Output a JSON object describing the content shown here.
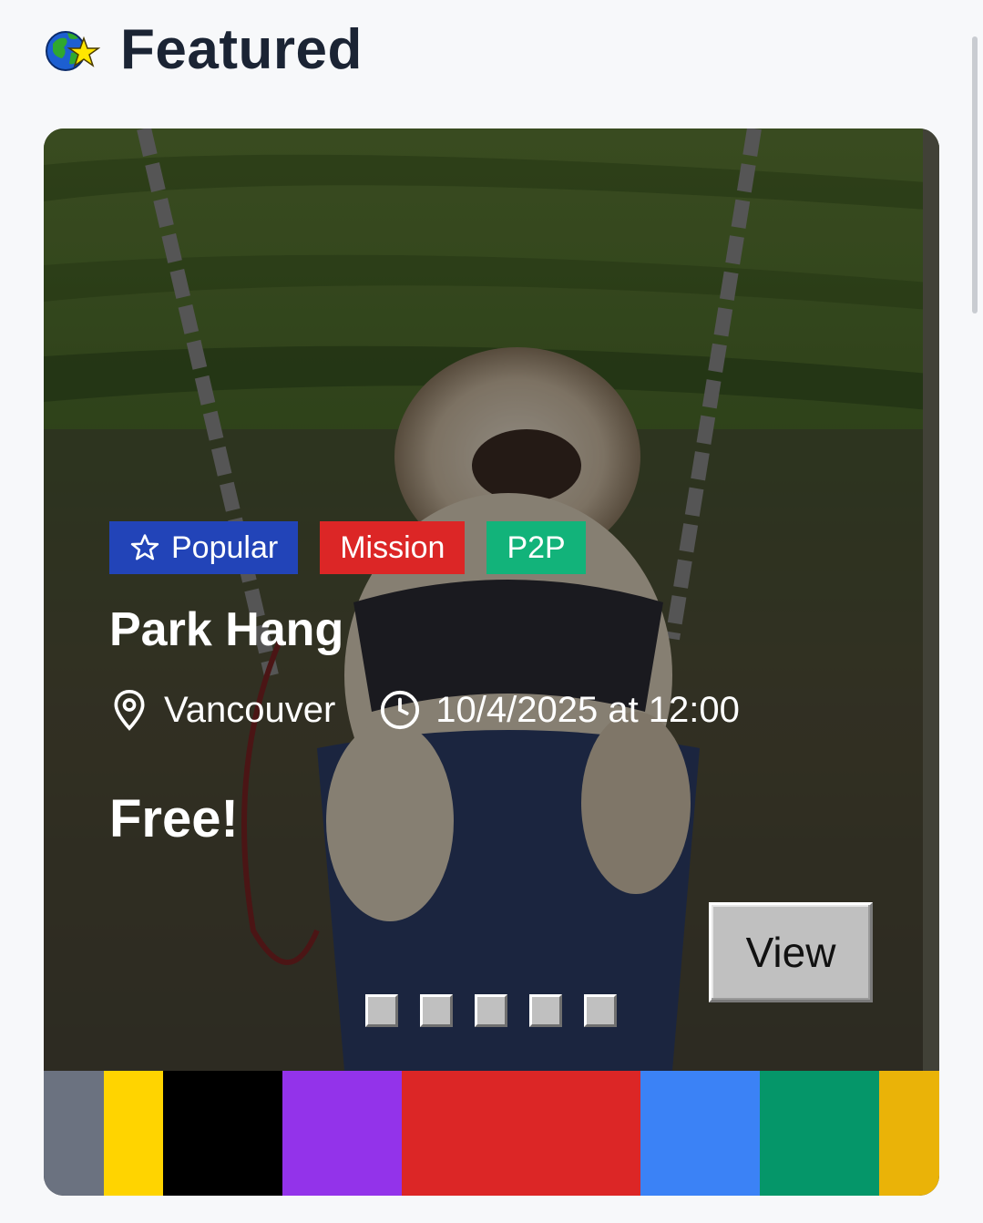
{
  "header": {
    "title": "Featured",
    "icon": "globe-star-icon"
  },
  "card": {
    "tags": [
      {
        "label": "Popular",
        "icon": "star-outline-icon",
        "color": "#2244b8"
      },
      {
        "label": "Mission",
        "color": "#dc2626"
      },
      {
        "label": "P2P",
        "color": "#12b37a"
      }
    ],
    "title": "Park Hang",
    "location": "Vancouver",
    "datetime": "10/4/2025 at 12:00",
    "price": "Free!",
    "view_label": "View",
    "slides_count": 5,
    "color_stripes": [
      "#6b7280",
      "#ffd400",
      "#000000",
      "#9333ea",
      "#dc2626",
      "#3b82f6",
      "#059669",
      "#eab308"
    ]
  }
}
